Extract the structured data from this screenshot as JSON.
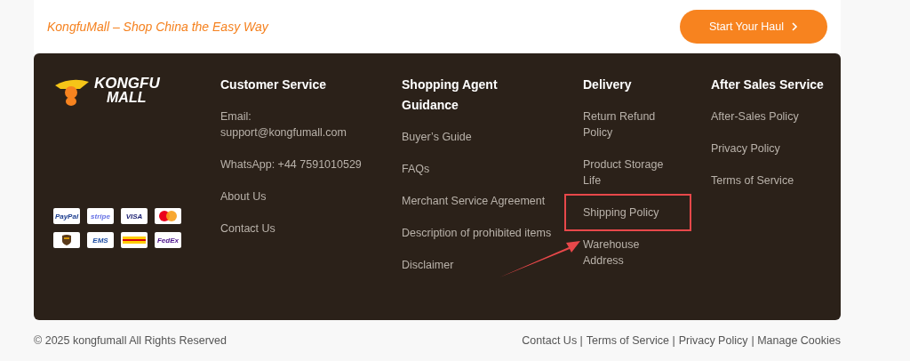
{
  "banner": {
    "tagline": "KongfuMall – Shop China the Easy Way",
    "button": "Start Your Haul"
  },
  "brand": {
    "line1": "KONGFU",
    "line2": "MALL"
  },
  "payments": [
    {
      "kind": "paypal",
      "label": "PayPal"
    },
    {
      "kind": "stripe",
      "label": "stripe"
    },
    {
      "kind": "visa",
      "label": "VISA"
    },
    {
      "kind": "mastercard"
    },
    {
      "kind": "ups"
    },
    {
      "kind": "ems",
      "label": "EMS"
    },
    {
      "kind": "dhl"
    },
    {
      "kind": "fedex",
      "label": "FedEx"
    }
  ],
  "columns": [
    {
      "heading": "Customer Service",
      "links": [
        {
          "label": "Email:",
          "value": "support@kongfumall.com",
          "highlighted": false
        },
        {
          "text": "WhatsApp: +44 7591010529",
          "highlighted": false
        },
        {
          "text": "About Us",
          "highlighted": false
        },
        {
          "text": "Contact Us",
          "highlighted": false
        }
      ]
    },
    {
      "heading": "Shopping Agent Guidance",
      "links": [
        {
          "text": "Buyer’s Guide",
          "highlighted": false
        },
        {
          "text": "FAQs",
          "highlighted": false
        },
        {
          "text": "Merchant Service Agreement",
          "highlighted": false
        },
        {
          "text": "Description of prohibited items",
          "highlighted": false
        },
        {
          "text": "Disclaimer",
          "highlighted": false
        }
      ]
    },
    {
      "heading": "Delivery",
      "links": [
        {
          "text": "Return Refund Policy",
          "highlighted": false
        },
        {
          "text": "Product Storage Life",
          "highlighted": false
        },
        {
          "text": "Shipping Policy",
          "highlighted": true
        },
        {
          "text": "Warehouse Address",
          "highlighted": false
        }
      ]
    },
    {
      "heading": "After Sales Service",
      "links": [
        {
          "text": "After-Sales Policy",
          "highlighted": false
        },
        {
          "text": "Privacy Policy",
          "highlighted": false
        },
        {
          "text": "Terms of Service",
          "highlighted": false
        }
      ]
    }
  ],
  "copyright": "© 2025 kongfumall All Rights Reserved",
  "bottom_links": [
    "Contact Us |",
    "Terms of Service |",
    "Privacy Policy",
    "| Manage Cookies"
  ]
}
